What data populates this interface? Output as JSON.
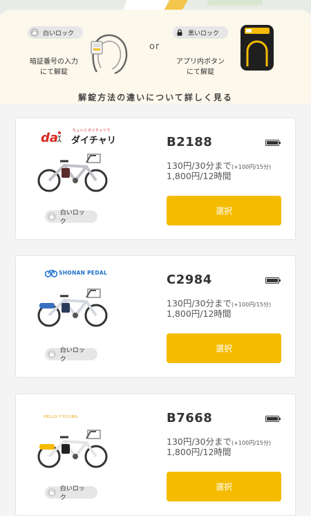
{
  "banner": {
    "white_lock_label": "白いロック",
    "white_lock_caption_line1": "暗証番号の入力",
    "white_lock_caption_line2": "にて解錠",
    "or_text": "or",
    "black_lock_label": "黒いロック",
    "black_lock_caption_line1": "アプリ内ボタン",
    "black_lock_caption_line2": "にて解錠",
    "learn_more": "解錠方法の違いについて詳しく見る"
  },
  "colors": {
    "accent": "#f4bb00",
    "banner_bg": "#fdf8ec",
    "page_bg": "#f4f4f4"
  },
  "bikes": [
    {
      "id": "B2188",
      "price_main": "130円/30分まで",
      "price_extra": "(+100円/15分)",
      "price_day": "1,800円/12時間",
      "select_label": "選択",
      "lock_label": "白いロック",
      "brand": "ダイチャリ",
      "brand_tagline": "ちょいとダイチャリで",
      "battery_icon": "battery-full-icon"
    },
    {
      "id": "C2984",
      "price_main": "130円/30分まで",
      "price_extra": "(+100円/15分)",
      "price_day": "1,800円/12時間",
      "select_label": "選択",
      "lock_label": "白いロック",
      "brand": "SHONAN PEDAL",
      "battery_icon": "battery-full-icon"
    },
    {
      "id": "B7668",
      "price_main": "130円/30分まで",
      "price_extra": "(+100円/15分)",
      "price_day": "1,800円/12時間",
      "select_label": "選択",
      "lock_label": "白いロック",
      "brand": "HELLO CYCLING",
      "battery_icon": "battery-full-icon"
    }
  ]
}
